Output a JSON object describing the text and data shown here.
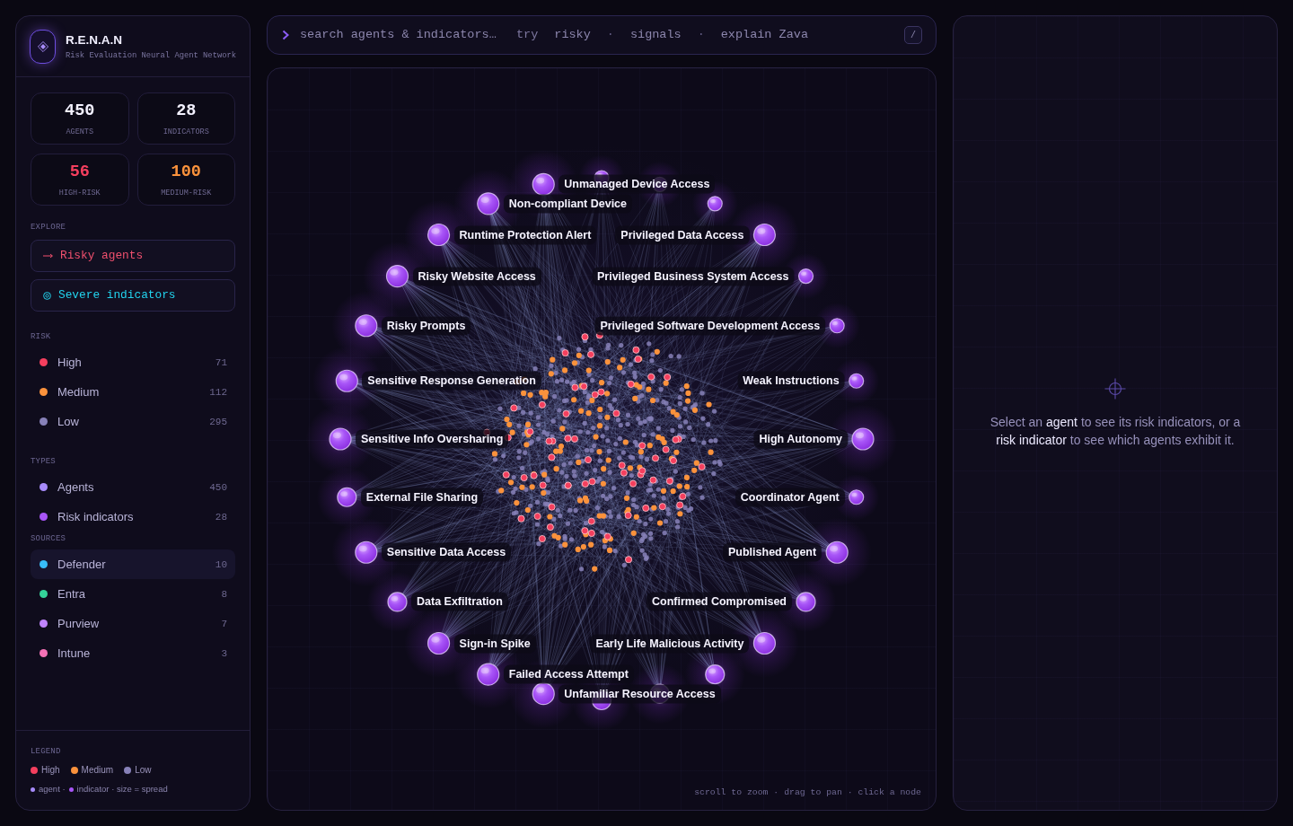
{
  "sidebar": {
    "brand": {
      "title": "R.E.N.A.N",
      "subtitle": "Risk Evaluation Neural Agent Network"
    },
    "stats": [
      {
        "value": "450",
        "label": "AGENTS",
        "color": "#f3f1ff"
      },
      {
        "value": "28",
        "label": "INDICATORS",
        "color": "#f3f1ff"
      },
      {
        "value": "56",
        "label": "HIGH-RISK",
        "color": "#f43f5e"
      },
      {
        "value": "100",
        "label": "MEDIUM-RISK",
        "color": "#fb923c"
      }
    ],
    "explore": {
      "heading": "EXPLORE",
      "items": [
        {
          "label": "Risky agents",
          "kind": "arrow",
          "color": "#f0506e"
        },
        {
          "label": "Severe indicators",
          "kind": "target",
          "color": "#22d3ee"
        }
      ]
    },
    "filters": [
      {
        "heading": "RISK",
        "items": [
          {
            "label": "High",
            "count": "71",
            "color": "#f43f5e",
            "selected": false
          },
          {
            "label": "Medium",
            "count": "112",
            "color": "#fb923c",
            "selected": false
          },
          {
            "label": "Low",
            "count": "295",
            "color": "#8781b8",
            "selected": false
          }
        ]
      },
      {
        "heading": "TYPES",
        "items": [
          {
            "label": "Agents",
            "count": "450",
            "color": "#a78bfa",
            "selected": false
          },
          {
            "label": "Risk indicators",
            "count": "28",
            "color": "#a855f7",
            "selected": false
          }
        ]
      },
      {
        "heading": "SOURCES",
        "items": [
          {
            "label": "Defender",
            "count": "10",
            "color": "#38bdf8",
            "selected": true
          },
          {
            "label": "Entra",
            "count": "8",
            "color": "#34d399",
            "selected": false
          },
          {
            "label": "Purview",
            "count": "7",
            "color": "#c084fc",
            "selected": false
          },
          {
            "label": "Intune",
            "count": "3",
            "color": "#f472b6",
            "selected": false
          }
        ]
      }
    ],
    "legend": {
      "heading": "LEGEND",
      "risk": [
        {
          "label": "High",
          "color": "#f43f5e"
        },
        {
          "label": "Medium",
          "color": "#fb923c"
        },
        {
          "label": "Low",
          "color": "#8781b8"
        }
      ],
      "notes": [
        {
          "label": "agent ·",
          "color": "#a78bfa"
        },
        {
          "label": "indicator · size = spread",
          "color": "#a855f7"
        }
      ]
    }
  },
  "search": {
    "placeholder": "search agents & indicators…",
    "hint": "try",
    "suggestions": [
      "risky",
      "signals",
      "explain Zava"
    ],
    "separator": "·",
    "shortcut": "/"
  },
  "graph": {
    "indicators": [
      {
        "kind": "small"
      },
      {
        "label": "Unmanaged Device Access",
        "kind": "large"
      },
      {
        "kind": "small"
      },
      {
        "label": "Non-compliant Device",
        "kind": "large"
      },
      {
        "kind": "small"
      },
      {
        "label": "Runtime Protection Alert",
        "kind": "large"
      },
      {
        "label": "Privileged Data Access",
        "kind": "large"
      },
      {
        "label": "Risky Website Access",
        "kind": "large"
      },
      {
        "label": "Privileged Business System Access",
        "kind": "small"
      },
      {
        "label": "Risky Prompts",
        "kind": "large"
      },
      {
        "label": "Privileged Software Development Access",
        "kind": "small"
      },
      {
        "label": "Sensitive Response Generation",
        "kind": "large"
      },
      {
        "label": "Weak Instructions",
        "kind": "small"
      },
      {
        "label": "Sensitive Info Oversharing",
        "kind": "large"
      },
      {
        "label": "High Autonomy",
        "kind": "large"
      },
      {
        "label": "External File Sharing",
        "kind": "medium"
      },
      {
        "label": "Coordinator Agent",
        "kind": "small"
      },
      {
        "label": "Sensitive Data Access",
        "kind": "large"
      },
      {
        "label": "Published Agent",
        "kind": "large"
      },
      {
        "label": "Data Exfiltration",
        "kind": "medium"
      },
      {
        "label": "Confirmed Compromised",
        "kind": "medium"
      },
      {
        "label": "Sign-in Spike",
        "kind": "large"
      },
      {
        "label": "Early Life Malicious Activity",
        "kind": "large"
      },
      {
        "label": "Failed Access Attempt",
        "kind": "large"
      },
      {
        "kind": "medium"
      },
      {
        "label": "Unfamiliar Resource Access",
        "kind": "large"
      },
      {
        "kind": "medium"
      },
      {
        "kind": "medium"
      }
    ],
    "hint": "scroll to zoom · drag to pan · click a node"
  },
  "detail_panel": {
    "message": "Select an **agent** to see its risk indicators, or a **risk indicator** to see which agents exhibit it."
  }
}
